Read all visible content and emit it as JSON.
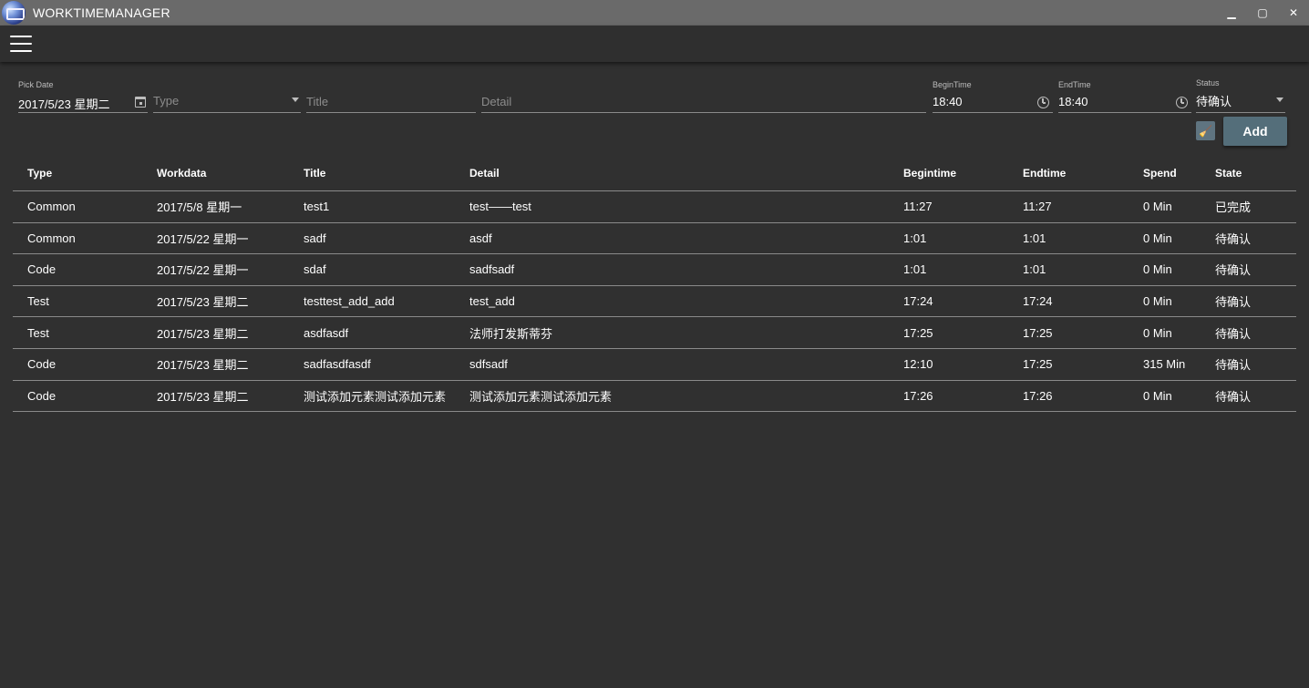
{
  "window": {
    "title": "WORKTIMEMANAGER",
    "minimize_glyph": "▁",
    "maximize_glyph": "▢",
    "close_glyph": "✕"
  },
  "form": {
    "pick_date": {
      "label": "Pick Date",
      "value": "2017/5/23 星期二"
    },
    "type": {
      "placeholder": "Type"
    },
    "title": {
      "placeholder": "Title"
    },
    "detail": {
      "placeholder": "Detail"
    },
    "begin_time": {
      "label": "BeginTime",
      "value": "18:40"
    },
    "end_time": {
      "label": "EndTime",
      "value": "18:40"
    },
    "status": {
      "label": "Status",
      "value": "待确认"
    },
    "clear_icon": "🧹",
    "add_label": "Add"
  },
  "table": {
    "headers": {
      "type": "Type",
      "workdata": "Workdata",
      "title": "Title",
      "detail": "Detail",
      "begintime": "Begintime",
      "endtime": "Endtime",
      "spend": "Spend",
      "state": "State"
    },
    "rows": [
      {
        "type": "Common",
        "workdata": "2017/5/8 星期一",
        "title": "test1",
        "detail": "test——test",
        "begintime": "11:27",
        "endtime": "11:27",
        "spend": "0 Min",
        "state": "已完成"
      },
      {
        "type": "Common",
        "workdata": "2017/5/22 星期一",
        "title": "sadf",
        "detail": "asdf",
        "begintime": "1:01",
        "endtime": "1:01",
        "spend": "0 Min",
        "state": "待确认"
      },
      {
        "type": "Code",
        "workdata": "2017/5/22 星期一",
        "title": "sdaf",
        "detail": "sadfsadf",
        "begintime": "1:01",
        "endtime": "1:01",
        "spend": "0 Min",
        "state": "待确认"
      },
      {
        "type": "Test",
        "workdata": "2017/5/23 星期二",
        "title": "testtest_add_add",
        "detail": "test_add",
        "begintime": "17:24",
        "endtime": "17:24",
        "spend": "0 Min",
        "state": "待确认"
      },
      {
        "type": "Test",
        "workdata": "2017/5/23 星期二",
        "title": "asdfasdf",
        "detail": "法师打发斯蒂芬",
        "begintime": "17:25",
        "endtime": "17:25",
        "spend": "0 Min",
        "state": "待确认"
      },
      {
        "type": "Code",
        "workdata": "2017/5/23 星期二",
        "title": "sadfasdfasdf",
        "detail": "sdfsadf",
        "begintime": "12:10",
        "endtime": "17:25",
        "spend": "315 Min",
        "state": "待确认"
      },
      {
        "type": "Code",
        "workdata": "2017/5/23 星期二",
        "title": "测试添加元素测试添加元素",
        "detail": "测试添加元素测试添加元素",
        "begintime": "17:26",
        "endtime": "17:26",
        "spend": "0 Min",
        "state": "待确认"
      }
    ]
  }
}
